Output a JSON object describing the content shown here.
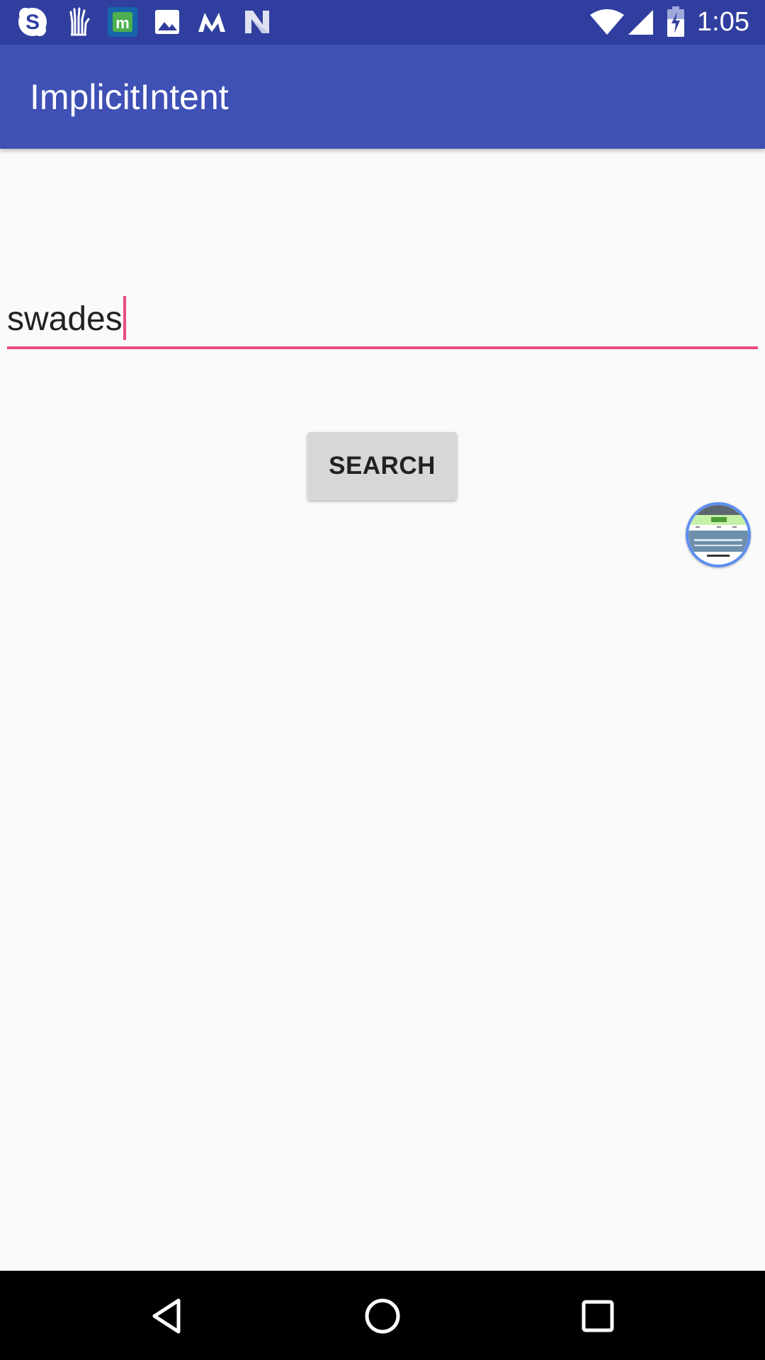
{
  "status_bar": {
    "time": "1:05",
    "background": "#303f9f",
    "notification_icons": [
      "skype-icon",
      "hand-icon",
      "m-app-icon",
      "gallery-icon",
      "myntra-icon",
      "n-icon"
    ],
    "system_icons": [
      "wifi-icon",
      "cellular-signal-icon",
      "battery-charging-icon"
    ]
  },
  "app_bar": {
    "title": "ImplicitIntent",
    "background": "#3f51b5"
  },
  "main": {
    "search_input": {
      "value": "swades",
      "accent_color": "#e94b82"
    },
    "search_button": {
      "label": "SEARCH"
    },
    "floating_bubble": {
      "icon": "screen-preview-bubble-icon"
    }
  },
  "nav_bar": {
    "buttons": [
      "back-icon",
      "home-icon",
      "recents-icon"
    ]
  }
}
